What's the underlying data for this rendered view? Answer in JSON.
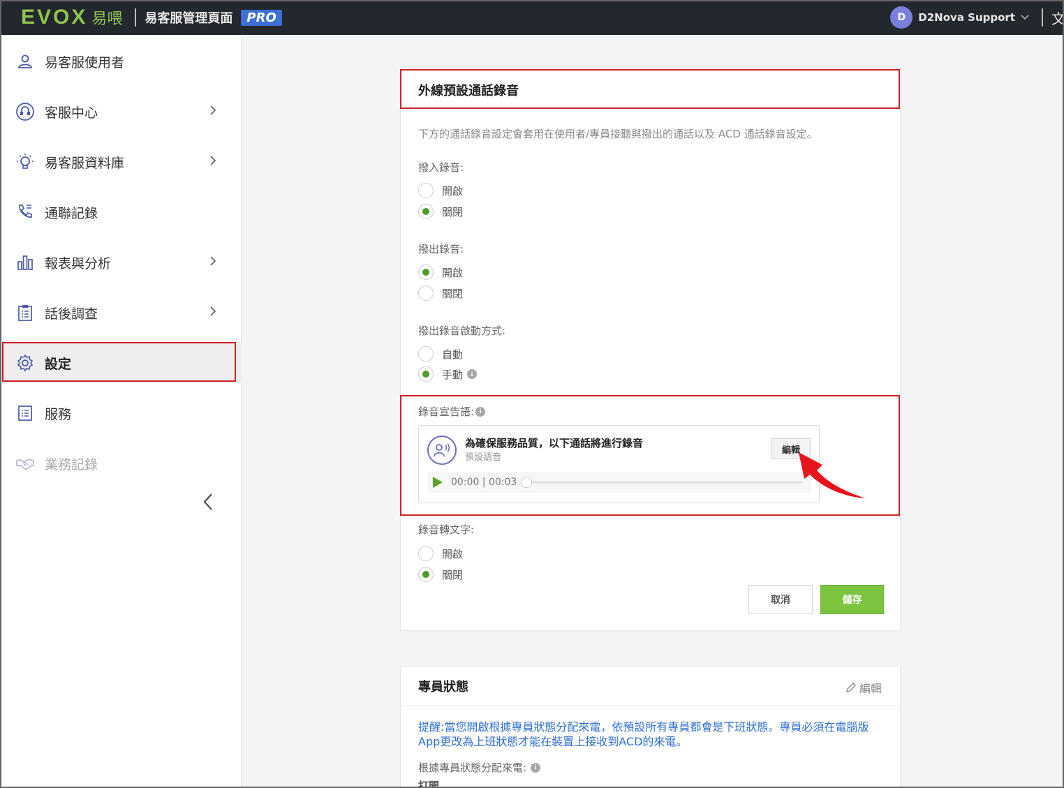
{
  "topbar": {
    "logo_evox": "EVOX",
    "logo_cn": "易喂",
    "title": "易客服管理頁面",
    "badge": "PRO",
    "avatar_initial": "D",
    "user_name": "D2Nova Support",
    "lang_glyph": "文"
  },
  "sidebar": {
    "items": [
      {
        "label": "易客服使用者",
        "icon": "user-icon"
      },
      {
        "label": "客服中心",
        "icon": "headset-icon"
      },
      {
        "label": "易客服資料庫",
        "icon": "lightbulb-icon"
      },
      {
        "label": "通聯記錄",
        "icon": "phone-log-icon"
      },
      {
        "label": "報表與分析",
        "icon": "bar-chart-icon"
      },
      {
        "label": "話後調查",
        "icon": "clipboard-icon"
      },
      {
        "label": "設定",
        "icon": "gear-icon"
      },
      {
        "label": "服務",
        "icon": "list-icon"
      },
      {
        "label": "業務記錄",
        "icon": "handshake-icon"
      }
    ]
  },
  "recording": {
    "title": "外線預設通話錄音",
    "description": "下方的通話錄音設定會套用在使用者/專員接聽與撥出的通話以及 ACD 通話錄音設定。",
    "inbound_label": "撥入錄音:",
    "outbound_label": "撥出錄音:",
    "outbound_trigger_label": "撥出錄音啟動方式:",
    "announcement_label": "錄音宣告語:",
    "transcription_label": "錄音轉文字:",
    "opt_on": "開啟",
    "opt_off": "關閉",
    "opt_auto": "自動",
    "opt_manual": "手動",
    "audio_title": "為確保服務品質，以下通話將進行錄音",
    "audio_subtitle": "預設語音",
    "edit_button": "編輯",
    "player_time": "00:00 | 00:03",
    "cancel_button": "取消",
    "save_button": "儲存",
    "selected": {
      "inbound": "off",
      "outbound": "on",
      "trigger": "manual",
      "transcription": "off"
    }
  },
  "agent_status": {
    "title": "專員狀態",
    "edit_link": "編輯",
    "reminder": "提醒:當您開啟根據專員狀態分配來電，依預設所有專員都會是下班狀態。專員必須在電腦版App更改為上班狀態才能在裝置上接收到ACD的來電。",
    "assign_label": "根據專員狀態分配來電:",
    "assign_value": "打開"
  },
  "colors": {
    "accent_green": "#7cc440",
    "highlight_red": "#d0202a",
    "link_blue": "#2f6fcf",
    "topbar": "#23282f"
  }
}
